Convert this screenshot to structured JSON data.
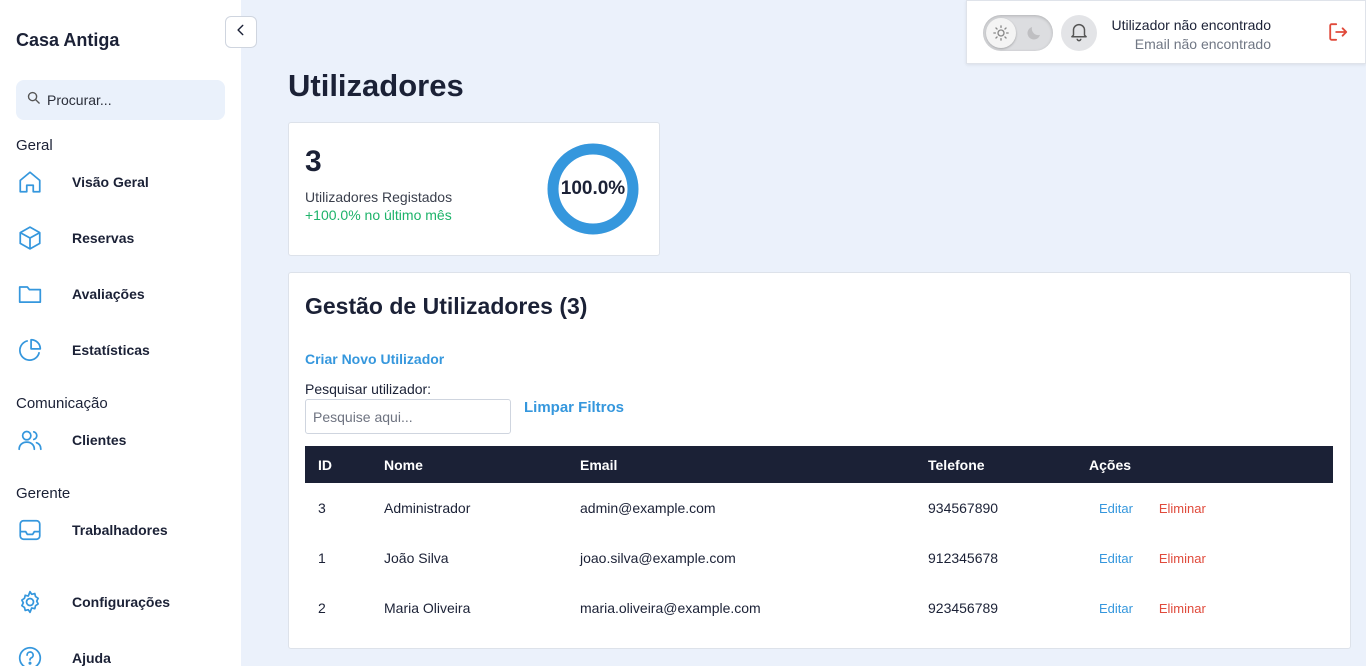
{
  "sidebar": {
    "brand": "Casa Antiga",
    "search_placeholder": "Procurar...",
    "sections": {
      "geral": "Geral",
      "comunicacao": "Comunicação",
      "gerente": "Gerente"
    },
    "items": [
      {
        "label": "Visão Geral",
        "icon": "home-icon"
      },
      {
        "label": "Reservas",
        "icon": "box-icon"
      },
      {
        "label": "Avaliações",
        "icon": "folder-icon"
      },
      {
        "label": "Estatísticas",
        "icon": "pie-chart-icon"
      },
      {
        "label": "Clientes",
        "icon": "users-icon"
      },
      {
        "label": "Trabalhadores",
        "icon": "inbox-icon"
      },
      {
        "label": "Configurações",
        "icon": "gear-icon"
      },
      {
        "label": "Ajuda",
        "icon": "help-icon"
      }
    ]
  },
  "header": {
    "user_name": "Utilizador não encontrado",
    "user_email": "Email não encontrado"
  },
  "main": {
    "title": "Utilizadores",
    "stat": {
      "count": "3",
      "label": "Utilizadores Registados",
      "growth": "+100.0% no último mês",
      "percent_text": "100.0%",
      "percent_value": 1.0
    },
    "management": {
      "title": "Gestão de Utilizadores (3)",
      "create_label": "Criar Novo Utilizador",
      "search_label": "Pesquisar utilizador:",
      "search_placeholder": "Pesquise aqui...",
      "clear_label": "Limpar Filtros",
      "columns": [
        "ID",
        "Nome",
        "Email",
        "Telefone",
        "Ações"
      ],
      "rows": [
        {
          "id": "3",
          "nome": "Administrador",
          "email": "admin@example.com",
          "telefone": "934567890"
        },
        {
          "id": "1",
          "nome": "João Silva",
          "email": "joao.silva@example.com",
          "telefone": "912345678"
        },
        {
          "id": "2",
          "nome": "Maria Oliveira",
          "email": "maria.oliveira@example.com",
          "telefone": "923456789"
        }
      ],
      "edit_label": "Editar",
      "delete_label": "Eliminar"
    }
  },
  "colors": {
    "accent": "#3597dd",
    "danger": "#e04a3b",
    "success": "#1db36a",
    "dark": "#1b2136",
    "background": "#ebf1fb"
  }
}
